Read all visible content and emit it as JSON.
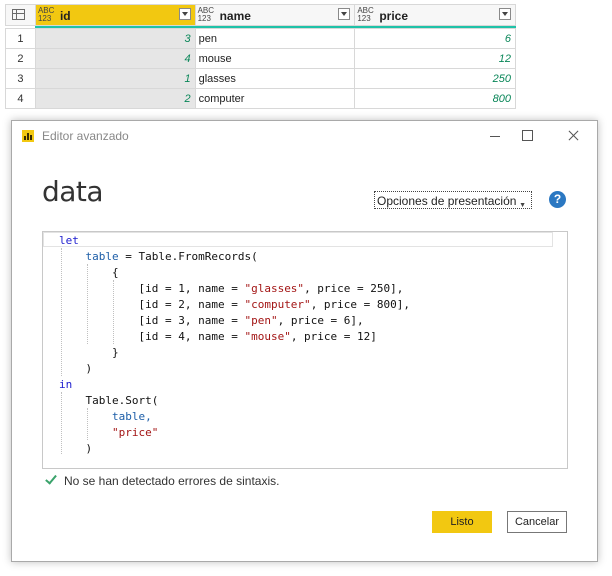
{
  "grid": {
    "columns": [
      {
        "type": "ABC\n123",
        "name": "id"
      },
      {
        "type": "ABC\n123",
        "name": "name"
      },
      {
        "type": "ABC\n123",
        "name": "price"
      }
    ],
    "rows": [
      {
        "n": "1",
        "id": "3",
        "name": "pen",
        "price": "6"
      },
      {
        "n": "2",
        "id": "4",
        "name": "mouse",
        "price": "12"
      },
      {
        "n": "3",
        "id": "1",
        "name": "glasses",
        "price": "250"
      },
      {
        "n": "4",
        "id": "2",
        "name": "computer",
        "price": "800"
      }
    ]
  },
  "dialog": {
    "title": "Editor avanzado",
    "query_name": "data",
    "display_options": "Opciones de presentación",
    "help": "?",
    "status": "No se han detectado errores de sintaxis.",
    "ok_label": "Listo",
    "cancel_label": "Cancelar"
  },
  "code": {
    "l1_let": "let",
    "l2_a": "table",
    "l2_b": " = Table.FromRecords(",
    "l3": "{",
    "r1_a": "[id = 1, name = ",
    "r1_s": "\"glasses\"",
    "r1_b": ", price = 250],",
    "r2_a": "[id = 2, name = ",
    "r2_s": "\"computer\"",
    "r2_b": ", price = 800],",
    "r3_a": "[id = 3, name = ",
    "r3_s": "\"pen\"",
    "r3_b": ", price = 6],",
    "r4_a": "[id = 4, name = ",
    "r4_s": "\"mouse\"",
    "r4_b": ", price = 12]",
    "l8": "}",
    "l9": ")",
    "l10_in": "in",
    "l11": "Table.Sort(",
    "l12": "table,",
    "l13": "\"price\"",
    "l14": ")"
  },
  "colors": {
    "accent": "#f2c811",
    "column_quality": "#1fc2a8",
    "help": "#2b78c2",
    "check": "#3aa36b"
  }
}
